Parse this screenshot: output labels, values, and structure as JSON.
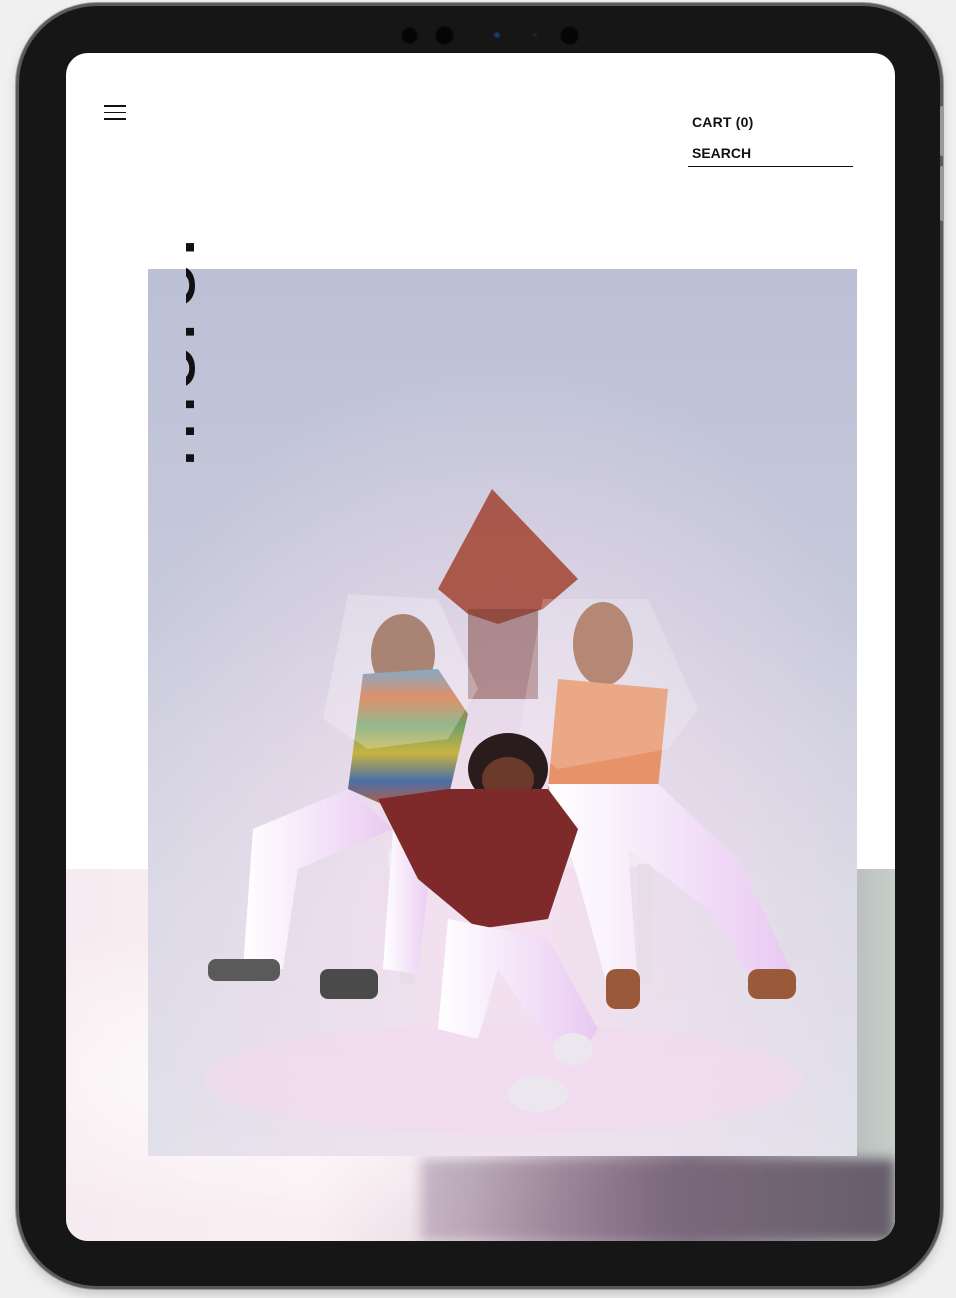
{
  "brand": {
    "logo_text": "more."
  },
  "header": {
    "cart_label": "CART (0)",
    "search_label": "SEARCH"
  },
  "icons": {
    "menu": "hamburger-menu-icon"
  },
  "colors": {
    "device_frame": "#161616",
    "text": "#111111",
    "hero_background": "#c7cadb",
    "bottom_band_pink": "#f6ebf0"
  }
}
